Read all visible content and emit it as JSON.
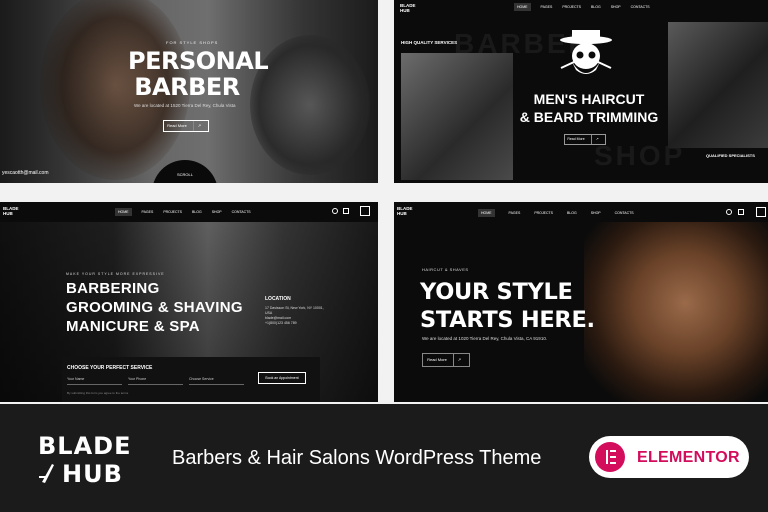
{
  "panel1": {
    "eyebrow": "FOR STYLE SHOPS",
    "title_line1": "PERSONAL",
    "title_line2": "BARBER",
    "address": "We are located at 1520 Tierra Del Rey, Chula Vista",
    "button": "Read More",
    "scroll": "SCROLL",
    "email": "yescaotth@mail.com"
  },
  "panel2": {
    "logo_line1": "BLADE",
    "logo_line2": "HUB",
    "nav": [
      "HOME",
      "PAGES",
      "PROJECTS",
      "BLOG",
      "SHOP",
      "CONTACTS"
    ],
    "label": "HIGH QUALITY SERVICES",
    "ghost_top": "BARBER",
    "ghost_bottom": "SHOP",
    "headline_line1": "MEN'S HAIRCUT",
    "headline_line2": "& BEARD TRIMMING",
    "button": "Read More",
    "caption": "QUALIFIED SPECIALISTS"
  },
  "panel3": {
    "logo_line1": "BLADE",
    "logo_line2": "HUB",
    "nav": [
      "HOME",
      "PAGES",
      "PROJECTS",
      "BLOG",
      "SHOP",
      "CONTACTS"
    ],
    "eyebrow": "MAKE YOUR STYLE MORE EXPRESSIVE",
    "line1": "BARBERING",
    "line2": "GROOMING & SHAVING",
    "line3": "MANICURE & SPA",
    "location_title": "LOCATION",
    "location_address": "17 Davisson St, New York, NY 10001, USA",
    "location_email": "blade@mail.com",
    "location_phone": "+1(800)123 456 789",
    "form_title": "CHOOSE YOUR PERFECT SERVICE",
    "field_name": "Your Name",
    "field_phone": "Your Phone",
    "field_service": "Choose Service",
    "form_button": "Book an Appointment",
    "form_note": "By submitting this form you agree to the terms"
  },
  "panel4": {
    "logo_line1": "BLADE",
    "logo_line2": "HUB",
    "nav": [
      "HOME",
      "PAGES",
      "PROJECTS",
      "BLOG",
      "SHOP",
      "CONTACTS"
    ],
    "eyebrow": "HAIRCUT & SHAVES",
    "headline_line1": "YOUR STYLE",
    "headline_line2": "STARTS HERE.",
    "address": "We are located at 1020 Tierra Del Rey, Chula Vista, CA 91910.",
    "button": "Read More"
  },
  "footer": {
    "brand_line1": "BLADE",
    "brand_line2": "HUB",
    "tagline": "Barbers & Hair Salons WordPress  Theme",
    "badge": "ELEMENTOR"
  },
  "colors": {
    "elementor": "#d30c5c",
    "footer_bg": "#1b1b1b",
    "panel_bg": "#0b0b0b"
  }
}
